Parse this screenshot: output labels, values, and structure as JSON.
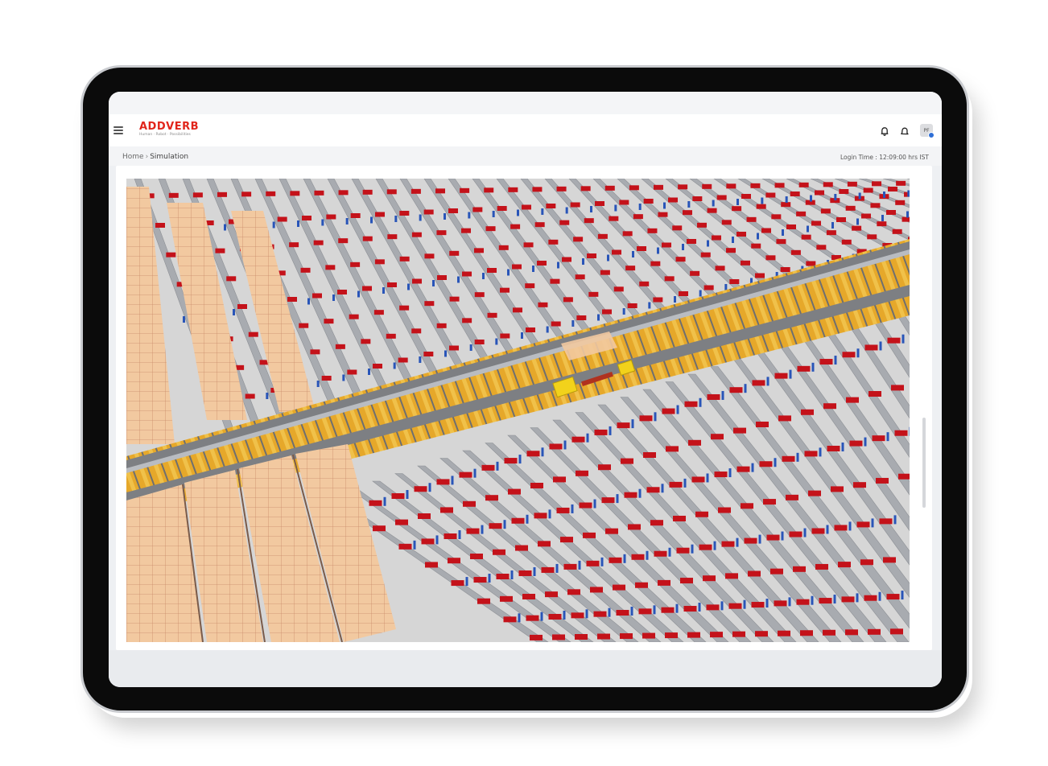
{
  "brand": {
    "name": "ADDVERB",
    "tagline": "Human · Robot · Possibilities",
    "color": "#e1251b"
  },
  "header": {
    "menu_icon": "hamburger-menu-icon",
    "notification_icon": "bell-icon",
    "alerts_icon": "bell-outline-icon",
    "user_initials": "PF"
  },
  "breadcrumb": {
    "home": "Home",
    "separator": "›",
    "current": "Simulation"
  },
  "login_time": "Login Time : 12:09:00 hrs IST",
  "simulation": {
    "view": "3D warehouse simulation",
    "colors": {
      "rails": "#a8abb0",
      "totes": "#c4121a",
      "uprights": "#2955b8",
      "main_aisle": "#e6a82a",
      "storage_floor": "#f2c9a0",
      "robot": "#f2d21b"
    }
  }
}
